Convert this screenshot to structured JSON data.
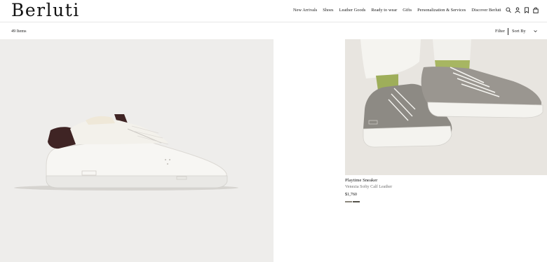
{
  "brand": {
    "logo": "Berluti"
  },
  "nav": {
    "items": [
      "New Arrivals",
      "Shoes",
      "Leather Goods",
      "Ready to wear",
      "Gifts",
      "Personalization & Services",
      "Discover Berluti"
    ]
  },
  "header_icons": [
    "search-icon",
    "account-icon",
    "wishlist-icon",
    "bag-icon"
  ],
  "toolbar": {
    "count": "49 Items",
    "filter": "Filter",
    "sort": "Sort By"
  },
  "products": [
    {
      "image": "white-sneaker-with-brown-heel-tab"
    },
    {
      "image": "grey-leather-sneaker-on-model",
      "name": "Playtime Sneaker",
      "material": "Venezia Softy Calf Leather",
      "price": "$1,760",
      "swatches": [
        "#8a867c",
        "#55534b"
      ]
    }
  ]
}
